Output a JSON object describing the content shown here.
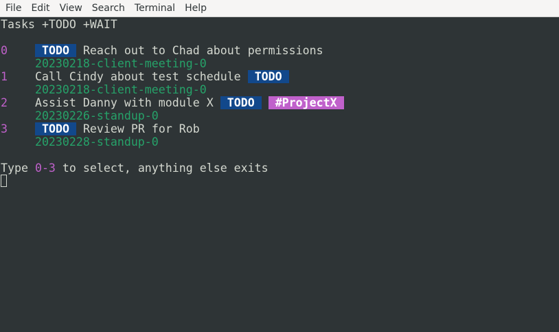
{
  "menubar": {
    "items": [
      "File",
      "Edit",
      "View",
      "Search",
      "Terminal",
      "Help"
    ]
  },
  "terminal": {
    "header": "Tasks +TODO +WAIT",
    "tasks": [
      {
        "index": "0",
        "pre_tag": "TODO",
        "text": "Reach out to Chad about permissions",
        "meeting": "20230218-client-meeting-0"
      },
      {
        "index": "1",
        "text": "Call Cindy about test schedule",
        "post_tag": "TODO",
        "meeting": "20230218-client-meeting-0"
      },
      {
        "index": "2",
        "text": "Assist Danny with module X",
        "post_tag": "TODO",
        "project_tag": "#ProjectX",
        "meeting": "20230226-standup-0"
      },
      {
        "index": "3",
        "pre_tag": "TODO",
        "text": "Review PR for Rob",
        "meeting": "20230228-standup-0"
      }
    ],
    "prompt": {
      "before": "Type ",
      "range": "0-3",
      "after": " to select, anything else exits"
    }
  },
  "colors": {
    "background": "#2e3436",
    "foreground": "#d3d7cf",
    "index": "#c061cb",
    "meeting": "#26a269",
    "todo_tag_bg": "#12488b",
    "project_tag_bg": "#c061cb"
  }
}
